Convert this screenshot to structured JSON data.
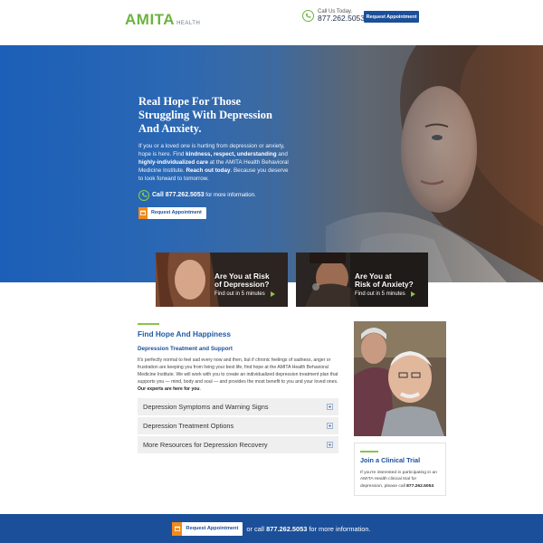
{
  "header": {
    "logo_main": "AMITA",
    "logo_sub": "HEALTH",
    "call_label": "Call Us Today.",
    "call_number": "877.262.5053",
    "request_button": "Request Appointment"
  },
  "hero": {
    "title_pre": "Real ",
    "title_bold": "Hope",
    "title_post": " For Those Struggling With Depression And Anxiety.",
    "text_1": "If you or a loved one is hurting from depression or anxiety, hope is here. Find ",
    "text_bold_1": "kindness, respect, understanding",
    "text_2": " and ",
    "text_bold_2": "highly-individualized care",
    "text_3": " at the AMITA Health Behavioral Medicine Institute. ",
    "text_bold_3": "Reach out today",
    "text_4": ". Because you deserve to look forward to tomorrow.",
    "call_prefix": "Call 877.262.5053",
    "call_suffix": " for more information.",
    "request_button": "Request Appointment"
  },
  "cards": [
    {
      "line1": "Are You at Risk",
      "line2": "of Depression?",
      "sub": "Find out in 5 minutes"
    },
    {
      "line1": "Are You at",
      "line2": "Risk of Anxiety?",
      "sub": "Find out in 5 minutes"
    }
  ],
  "main": {
    "section_title": "Find Hope And Happiness",
    "sub_title": "Depression Treatment and Support",
    "body": "It's perfectly normal to feel sad every now and then, but if chronic feelings of sadness, anger or frustration are keeping you from living your best life, find hope at the AMITA Health Behavioral Medicine Institute. We will work with you to create an individualized depression treatment plan that supports you — mind, body and soul — and provides the most benefit to you and your loved ones. ",
    "body_bold": "Our experts are here for you",
    "body_end": ".",
    "accordion": [
      "Depression Symptoms and Warning Signs",
      "Depression Treatment Options",
      "More Resources for Depression Recovery"
    ]
  },
  "sidebar": {
    "title": "Join a Clinical Trial",
    "text": "If you're interested in participating in an AMITA Health clinical trial for depression, please call ",
    "text_bold": "877.262.5053",
    "text_end": "."
  },
  "footer": {
    "request_button": "Request Appointment",
    "or_call": "or call ",
    "number": "877.262.5053",
    "suffix": " for more information."
  },
  "colors": {
    "brand_blue": "#1b4f99",
    "brand_green": "#6cb33f",
    "accent_orange": "#f08a1c"
  }
}
